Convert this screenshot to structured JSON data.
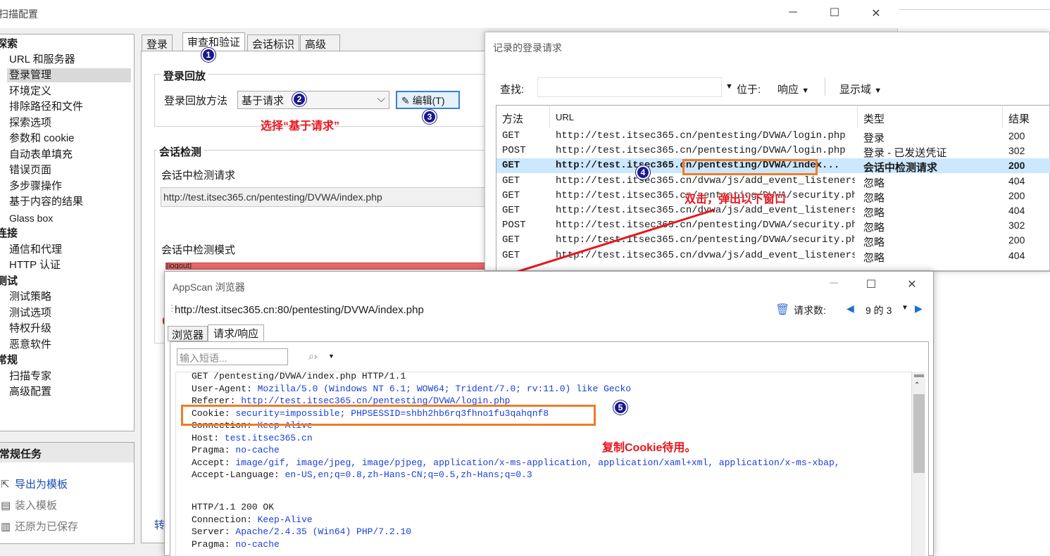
{
  "main_window": {
    "title": "扫描配置",
    "controls": {
      "minimize": "─",
      "maximize": "☐",
      "close": "✕"
    }
  },
  "nav": {
    "sections": [
      {
        "title": "探索",
        "items": [
          "URL 和服务器",
          "登录管理",
          "环境定义",
          "排除路径和文件",
          "探索选项",
          "参数和 cookie",
          "自动表单填充",
          "错误页面",
          "多步骤操作",
          "基于内容的结果",
          "Glass box"
        ]
      },
      {
        "title": "连接",
        "items": [
          "通信和代理",
          "HTTP 认证"
        ]
      },
      {
        "title": "测试",
        "items": [
          "测试策略",
          "测试选项",
          "特权升级",
          "恶意软件"
        ]
      },
      {
        "title": "常规",
        "items": [
          "扫描专家",
          "高级配置"
        ]
      }
    ],
    "selected": "登录管理"
  },
  "tasks": {
    "header": "常规任务",
    "items": [
      "导出为模板",
      "装入模板",
      "还原为已保存"
    ]
  },
  "tabs": [
    "登录",
    "审查和验证",
    "会话标识",
    "高级"
  ],
  "login_replay": {
    "group_title": "登录回放",
    "method_label": "登录回放方法",
    "method_value": "基于请求",
    "edit_button": "编辑(T)"
  },
  "session_detect": {
    "group_title": "会话检测",
    "request_label": "会话中检测请求",
    "request_value": "http://test.itsec365.cn/pentesting/DVWA/index.php",
    "pattern_label": "会话中检测模式",
    "pattern_value": "[logout]",
    "left_truncated_text": "转"
  },
  "annotations": {
    "badges": [
      "1",
      "2",
      "3",
      "4",
      "5"
    ],
    "select_request": "选择“基于请求”",
    "double_click": "双击，弹出以下窗口",
    "copy_cookie": "复制Cookie待用。"
  },
  "recorded_requests": {
    "title": "记录的登录请求",
    "search_label": "查找:",
    "located_at": "位于:",
    "response_dropdown": "响应",
    "show_domain": "显示域",
    "columns": [
      "方法",
      "URL",
      "类型",
      "结果"
    ],
    "rows": [
      {
        "method": "GET",
        "url": "http://test.itsec365.cn/pentesting/DVWA/login.php",
        "type": "登录",
        "result": "200"
      },
      {
        "method": "POST",
        "url": "http://test.itsec365.cn/pentesting/DVWA/login.php",
        "type": "登录 - 已发送凭证",
        "result": "302"
      },
      {
        "method": "GET",
        "url": "http://test.itsec365.cn/pentesting/DVWA/index...",
        "type": "会话中检测请求",
        "result": "200"
      },
      {
        "method": "GET",
        "url": "http://test.itsec365.cn/dvwa/js/add_event_listeners.js",
        "type": "忽略",
        "result": "404"
      },
      {
        "method": "GET",
        "url": "http://test.itsec365.cn/pentesting/DVWA/security.php",
        "type": "忽略",
        "result": "200"
      },
      {
        "method": "GET",
        "url": "http://test.itsec365.cn/dvwa/js/add_event_listeners.js",
        "type": "忽略",
        "result": "404"
      },
      {
        "method": "POST",
        "url": "http://test.itsec365.cn/pentesting/DVWA/security.php",
        "type": "忽略",
        "result": "302"
      },
      {
        "method": "GET",
        "url": "http://test.itsec365.cn/pentesting/DVWA/security.php",
        "type": "忽略",
        "result": "200"
      },
      {
        "method": "GET",
        "url": "http://test.itsec365.cn/dvwa/js/add_event_listeners.js",
        "type": "忽略",
        "result": "404"
      }
    ],
    "selected_row": 2
  },
  "browser": {
    "title": "AppScan 浏览器",
    "url": "http://test.itsec365.cn:80/pentesting/DVWA/index.php",
    "request_count_label": "请求数:",
    "request_count_value": "9 的 3",
    "tabs": [
      "浏览器",
      "请求/响应"
    ],
    "phrase_placeholder": "输入短语...",
    "request_lines": [
      {
        "k": "GET /pentesting/DVWA/index.php HTTP/1.1",
        "v": ""
      },
      {
        "k": "User-Agent: ",
        "v": "Mozilla/5.0 (Windows NT 6.1; WOW64; Trident/7.0; rv:11.0) like Gecko"
      },
      {
        "k": "Referer: ",
        "v": "http://test.itsec365.cn/pentesting/DVWA/login.php"
      },
      {
        "k": "Cookie: ",
        "v": "security=impossible; PHPSESSID=shbh2hb6rq3fhno1fu3qahqnf8"
      },
      {
        "k": "Connection: ",
        "v": "Keep-Alive"
      },
      {
        "k": "Host: ",
        "v": "test.itsec365.cn"
      },
      {
        "k": "Pragma: ",
        "v": "no-cache"
      },
      {
        "k": "Accept: ",
        "v": "image/gif, image/jpeg, image/pjpeg, application/x-ms-application, application/xaml+xml, application/x-ms-xbap,"
      },
      {
        "k": "Accept-Language: ",
        "v": "en-US,en;q=0.8,zh-Hans-CN;q=0.5,zh-Hans;q=0.3"
      }
    ],
    "response_lines": [
      {
        "k": "HTTP/1.1 200 OK",
        "v": ""
      },
      {
        "k": "Connection: ",
        "v": "Keep-Alive"
      },
      {
        "k": "Server: ",
        "v": "Apache/2.4.35 (Win64) PHP/7.2.10"
      },
      {
        "k": "Pragma: ",
        "v": "no-cache"
      }
    ]
  },
  "colors": {
    "annotation_red": "#e8141c",
    "highlight_orange": "#f07c2a",
    "badge_navy": "#1a1a8c",
    "selection_blue": "#cce8ff",
    "header_value_blue": "#1a3fd6"
  }
}
